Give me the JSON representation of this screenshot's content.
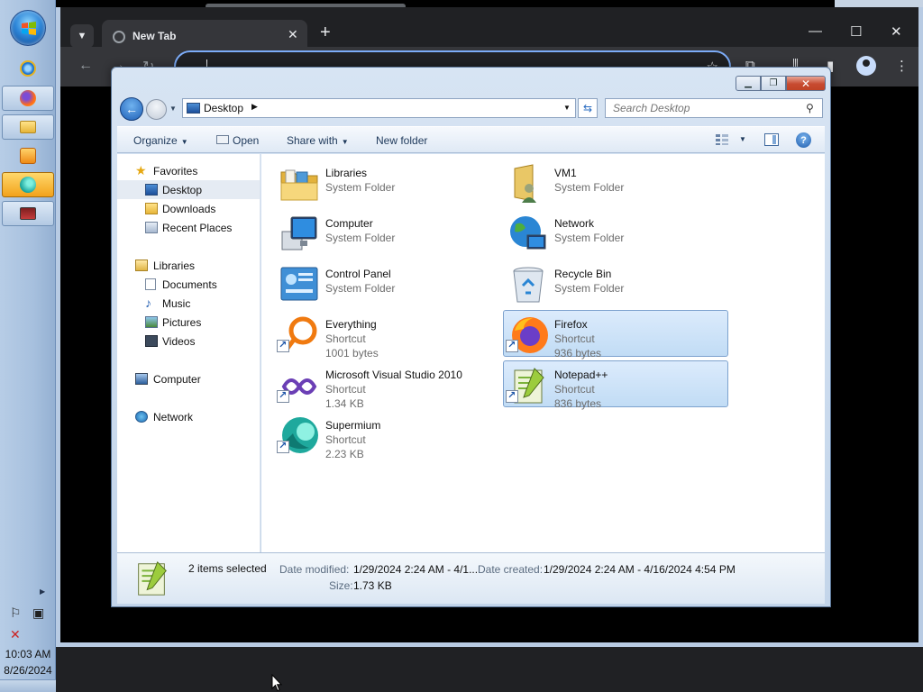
{
  "taskbar": {
    "clock_time": "10:03 AM",
    "clock_date": "8/26/2024"
  },
  "browser": {
    "tab_title": "New Tab",
    "tab_close": "✕",
    "new_tab": "+",
    "minimize": "—",
    "maximize": "☐",
    "close": "✕"
  },
  "explorer": {
    "location": "Desktop",
    "search_placeholder": "Search Desktop",
    "commands": {
      "organize": "Organize",
      "open": "Open",
      "share_with": "Share with",
      "new_folder": "New folder"
    },
    "nav": {
      "favorites": "Favorites",
      "desktop": "Desktop",
      "downloads": "Downloads",
      "recent_places": "Recent Places",
      "libraries": "Libraries",
      "documents": "Documents",
      "music": "Music",
      "pictures": "Pictures",
      "videos": "Videos",
      "computer": "Computer",
      "network": "Network"
    },
    "items": [
      {
        "name": "Libraries",
        "type": "System Folder",
        "size": ""
      },
      {
        "name": "VM1",
        "type": "System Folder",
        "size": ""
      },
      {
        "name": "Computer",
        "type": "System Folder",
        "size": ""
      },
      {
        "name": "Network",
        "type": "System Folder",
        "size": ""
      },
      {
        "name": "Control Panel",
        "type": "System Folder",
        "size": ""
      },
      {
        "name": "Recycle Bin",
        "type": "System Folder",
        "size": ""
      },
      {
        "name": "Everything",
        "type": "Shortcut",
        "size": "1001 bytes"
      },
      {
        "name": "Firefox",
        "type": "Shortcut",
        "size": "936 bytes"
      },
      {
        "name": "Microsoft Visual Studio 2010",
        "type": "Shortcut",
        "size": "1.34 KB"
      },
      {
        "name": "Notepad++",
        "type": "Shortcut",
        "size": "836 bytes"
      },
      {
        "name": "Supermium",
        "type": "Shortcut",
        "size": "2.23 KB"
      }
    ],
    "details": {
      "selection": "2 items selected",
      "date_modified_label": "Date modified:",
      "date_modified": "1/29/2024 2:24 AM - 4/1...",
      "date_created_label": "Date created:",
      "date_created": "1/29/2024 2:24 AM - 4/16/2024 4:54 PM",
      "size_label": "Size:",
      "size": "1.73 KB"
    }
  },
  "colors": {
    "selection_fill": "#cfe3f8",
    "selection_border": "#7da2ce",
    "browser_dark": "#202124",
    "omnibox_focus": "#7cacf8"
  }
}
